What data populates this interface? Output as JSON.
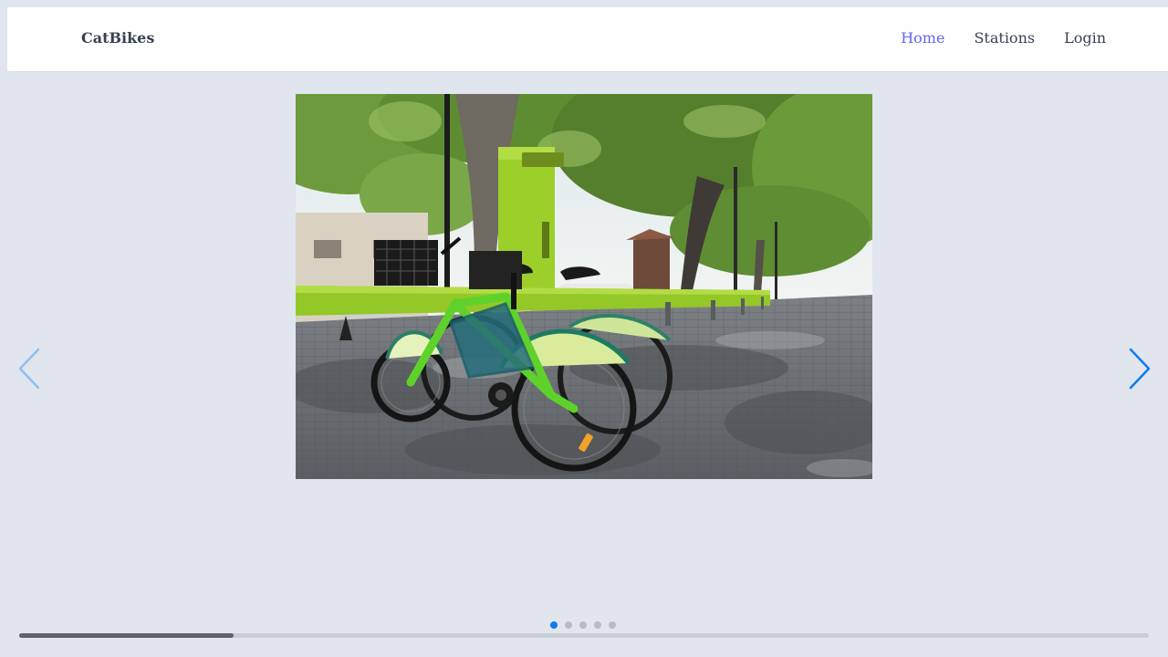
{
  "navbar": {
    "brand": "CatBikes",
    "links": [
      {
        "label": "Home",
        "active": true
      },
      {
        "label": "Stations",
        "active": false
      },
      {
        "label": "Login",
        "active": false
      }
    ]
  },
  "carousel": {
    "slide_count": 5,
    "active_index": 0,
    "progress": 0.19,
    "colors": {
      "accent": "#0a7cf0",
      "arrow_prev": "#8ec1f2",
      "dot_inactive": "#b7bcc4",
      "nav_active": "#6366f1"
    },
    "icons": {
      "prev": "chevron-left-icon",
      "next": "chevron-right-icon"
    }
  }
}
